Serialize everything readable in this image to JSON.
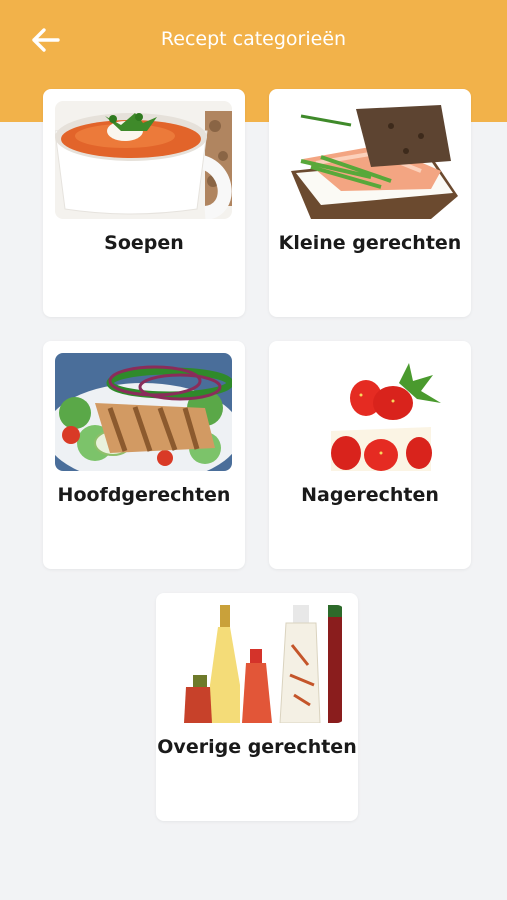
{
  "header": {
    "title": "Recept categorieën",
    "background_color": "#f2b24a",
    "back_icon": "arrow-left-icon"
  },
  "categories": [
    {
      "label": "Soepen",
      "image": "tomato-soup-cup-image"
    },
    {
      "label": "Kleine gerechten",
      "image": "salmon-sandwich-image"
    },
    {
      "label": "Hoofdgerechten",
      "image": "grilled-chicken-salad-image"
    },
    {
      "label": "Nagerechten",
      "image": "strawberry-cake-image"
    },
    {
      "label": "Overige gerechten",
      "image": "infused-oil-bottles-image"
    }
  ]
}
